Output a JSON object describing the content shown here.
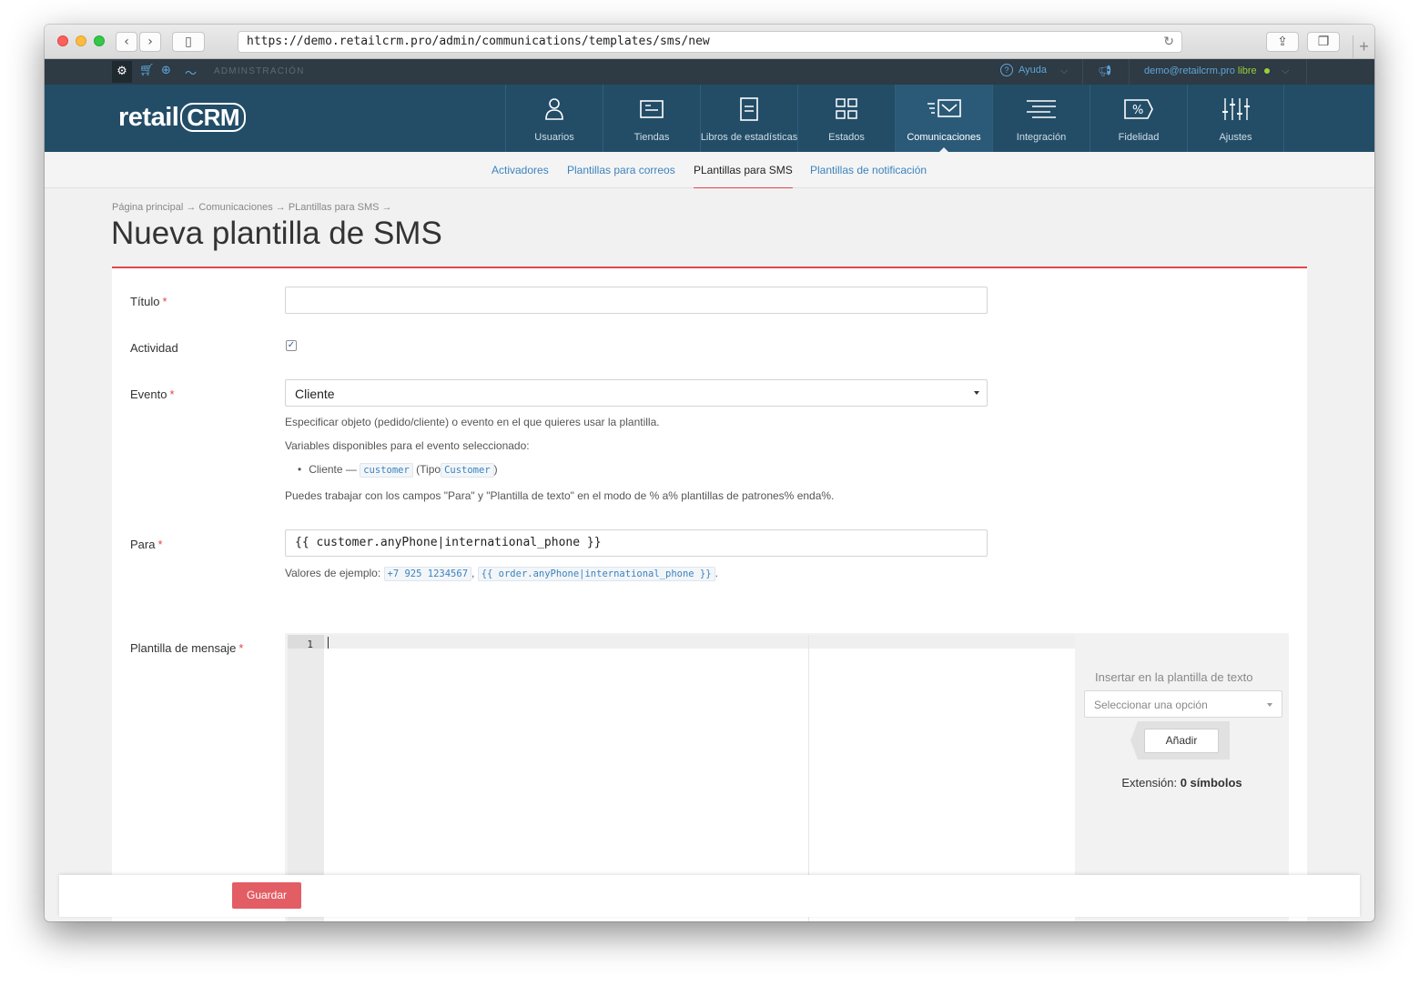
{
  "browser": {
    "url": "https://demo.retailcrm.pro/admin/communications/templates/sms/new"
  },
  "adminbar": {
    "section_label": "ADMINSTRACIÓN",
    "help_label": "Ayuda",
    "user_email": "demo@retailcrm.pro",
    "plan_label": "libre"
  },
  "brand": {
    "logo_text_left": "retail",
    "logo_text_right": "CRM"
  },
  "mainnav": {
    "items": [
      {
        "label": "Usuarios",
        "icon": "user-icon"
      },
      {
        "label": "Tiendas",
        "icon": "store-icon"
      },
      {
        "label": "Libros de estadísticas",
        "icon": "document-icon"
      },
      {
        "label": "Estados",
        "icon": "grid-icon"
      },
      {
        "label": "Comunicaciones",
        "icon": "mail-icon",
        "active": true
      },
      {
        "label": "Integración",
        "icon": "lines-icon"
      },
      {
        "label": "Fidelidad",
        "icon": "percent-tag-icon"
      },
      {
        "label": "Ajustes",
        "icon": "sliders-icon"
      }
    ]
  },
  "subnav": {
    "items": [
      {
        "label": "Activadores"
      },
      {
        "label": "Plantillas para correos"
      },
      {
        "label": "PLantillas para SMS",
        "active": true
      },
      {
        "label": "Plantillas de notificación"
      }
    ]
  },
  "breadcrumb": "Página principal → Comunicaciones → PLantillas para SMS →",
  "page_title": "Nueva plantilla de SMS",
  "form": {
    "title_label": "Título",
    "title_value": "",
    "activity_label": "Actividad",
    "activity_checked": true,
    "event_label": "Evento",
    "event_value": "Cliente",
    "event_hint": "Especificar objeto (pedido/cliente) o evento en el que quieres usar la plantilla.",
    "variables_hint": "Variables disponibles para el evento seleccionado:",
    "variable_item": {
      "name": "Cliente —",
      "code": "customer",
      "type_prefix": "(Tipo",
      "type_code": "Customer",
      "type_suffix": ")"
    },
    "patterns_hint": "Puedes trabajar con los campos \"Para\" y \"Plantilla de texto\" en el modo de % a% plantillas de patrones% enda%.",
    "to_label": "Para",
    "to_value": "{{ customer.anyPhone|international_phone }}",
    "examples_prefix": "Valores de ejemplo:",
    "example_1": "+7 925 1234567",
    "example_2": "{{ order.anyPhone|international_phone }}",
    "message_label": "Plantilla de mensaje",
    "line_number": "1",
    "insert_label": "Insertar en la plantilla de texto",
    "insert_placeholder": "Seleccionar una opción",
    "add_button": "Añadir",
    "length_label": "Extensión:",
    "length_value": "0 símbolos"
  },
  "savebar": {
    "save_button": "Guardar"
  },
  "colors": {
    "nav_bg": "#234d67",
    "accent_red": "#e0474d",
    "link_blue": "#3b83be"
  }
}
